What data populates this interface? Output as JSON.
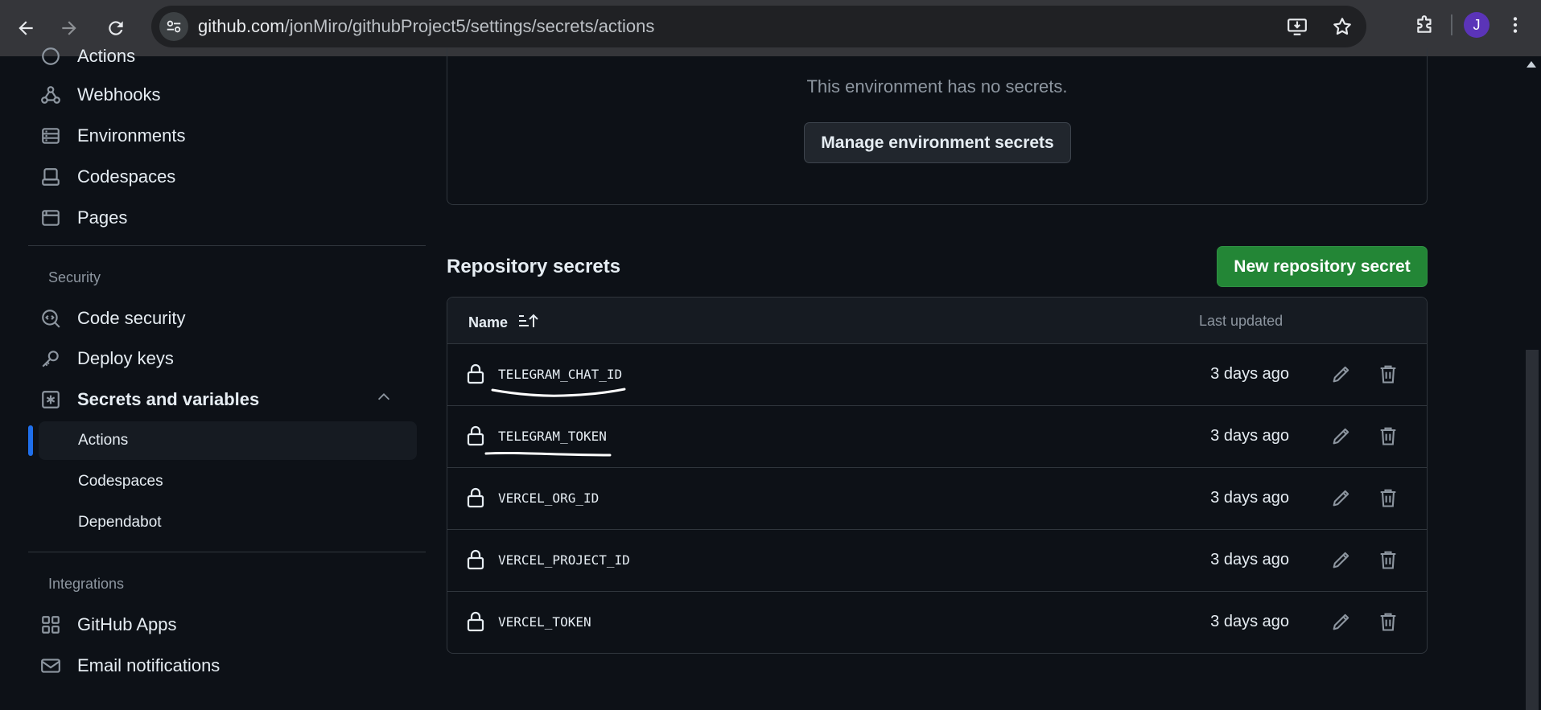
{
  "browser": {
    "url_host": "github.com",
    "url_path": "/jonMiro/githubProject5/settings/secrets/actions",
    "avatar_letter": "J"
  },
  "sidebar": {
    "items_top": [
      {
        "label": "Actions",
        "icon": "play-icon"
      },
      {
        "label": "Webhooks",
        "icon": "webhook-icon"
      },
      {
        "label": "Environments",
        "icon": "server-icon"
      },
      {
        "label": "Codespaces",
        "icon": "codespaces-icon"
      },
      {
        "label": "Pages",
        "icon": "browser-icon"
      }
    ],
    "security_heading": "Security",
    "security_items": [
      {
        "label": "Code security",
        "icon": "codescan-icon"
      },
      {
        "label": "Deploy keys",
        "icon": "key-icon"
      },
      {
        "label": "Secrets and variables",
        "icon": "asterisk-icon"
      }
    ],
    "sub_items": [
      {
        "label": "Actions"
      },
      {
        "label": "Codespaces"
      },
      {
        "label": "Dependabot"
      }
    ],
    "integrations_heading": "Integrations",
    "integration_items": [
      {
        "label": "GitHub Apps",
        "icon": "apps-icon"
      },
      {
        "label": "Email notifications",
        "icon": "mail-icon"
      }
    ]
  },
  "environment": {
    "empty_text": "This environment has no secrets.",
    "manage_button": "Manage environment secrets"
  },
  "repo_secrets": {
    "title": "Repository secrets",
    "new_button": "New repository secret",
    "col_name": "Name",
    "col_updated": "Last updated",
    "rows": [
      {
        "name": "TELEGRAM_CHAT_ID",
        "updated": "3 days ago"
      },
      {
        "name": "TELEGRAM_TOKEN",
        "updated": "3 days ago"
      },
      {
        "name": "VERCEL_ORG_ID",
        "updated": "3 days ago"
      },
      {
        "name": "VERCEL_PROJECT_ID",
        "updated": "3 days ago"
      },
      {
        "name": "VERCEL_TOKEN",
        "updated": "3 days ago"
      }
    ]
  },
  "colors": {
    "accent": "#1f6feb",
    "primary_button": "#238636",
    "background": "#0d1117"
  }
}
